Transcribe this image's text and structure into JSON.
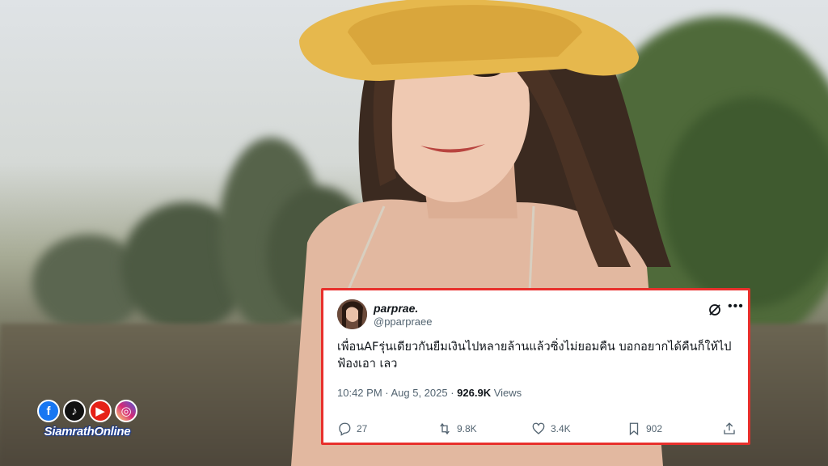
{
  "brand": {
    "name": "SiamrathOnline",
    "social_icons": [
      "facebook-icon",
      "tiktok-icon",
      "youtube-icon",
      "instagram-icon"
    ],
    "colors": {
      "facebook": "#1877f2",
      "tiktok": "#111111",
      "youtube": "#e62117",
      "instagram": "#d6249f"
    }
  },
  "tweet": {
    "display_name": "parprae.",
    "handle": "@pparpraee",
    "text": "เพื่อนAFรุ่นเดียวกันยืมเงินไปหลายล้านแล้วซิ่งไม่ยอมคืน บอกอยากได้คืนก็ให้ไปฟ้องเอา เลว",
    "time": "10:42 PM · Aug 5, 2025 · ",
    "views_count": "926.9K",
    "views_label": " Views",
    "replies": "27",
    "reposts": "9.8K",
    "likes": "3.4K",
    "bookmarks": "902",
    "border_color": "#e8302c"
  }
}
